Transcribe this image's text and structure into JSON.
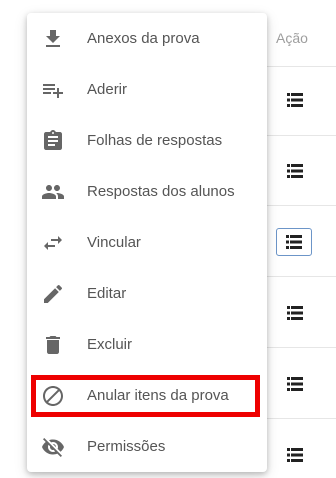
{
  "table": {
    "header_action": "Ação"
  },
  "menu": {
    "items": [
      {
        "label": "Anexos da prova",
        "icon": "download-icon"
      },
      {
        "label": "Aderir",
        "icon": "playlist-add-icon"
      },
      {
        "label": "Folhas de respostas",
        "icon": "assignment-icon"
      },
      {
        "label": "Respostas dos alunos",
        "icon": "people-icon"
      },
      {
        "label": "Vincular",
        "icon": "swap-horiz-icon"
      },
      {
        "label": "Editar",
        "icon": "pencil-icon"
      },
      {
        "label": "Excluir",
        "icon": "trash-icon"
      },
      {
        "label": "Anular itens da prova",
        "icon": "block-icon"
      },
      {
        "label": "Permissões",
        "icon": "eye-off-icon"
      }
    ]
  },
  "colors": {
    "highlight": "#ee0000",
    "selected_border": "#6c95c8",
    "icon": "#666666"
  }
}
